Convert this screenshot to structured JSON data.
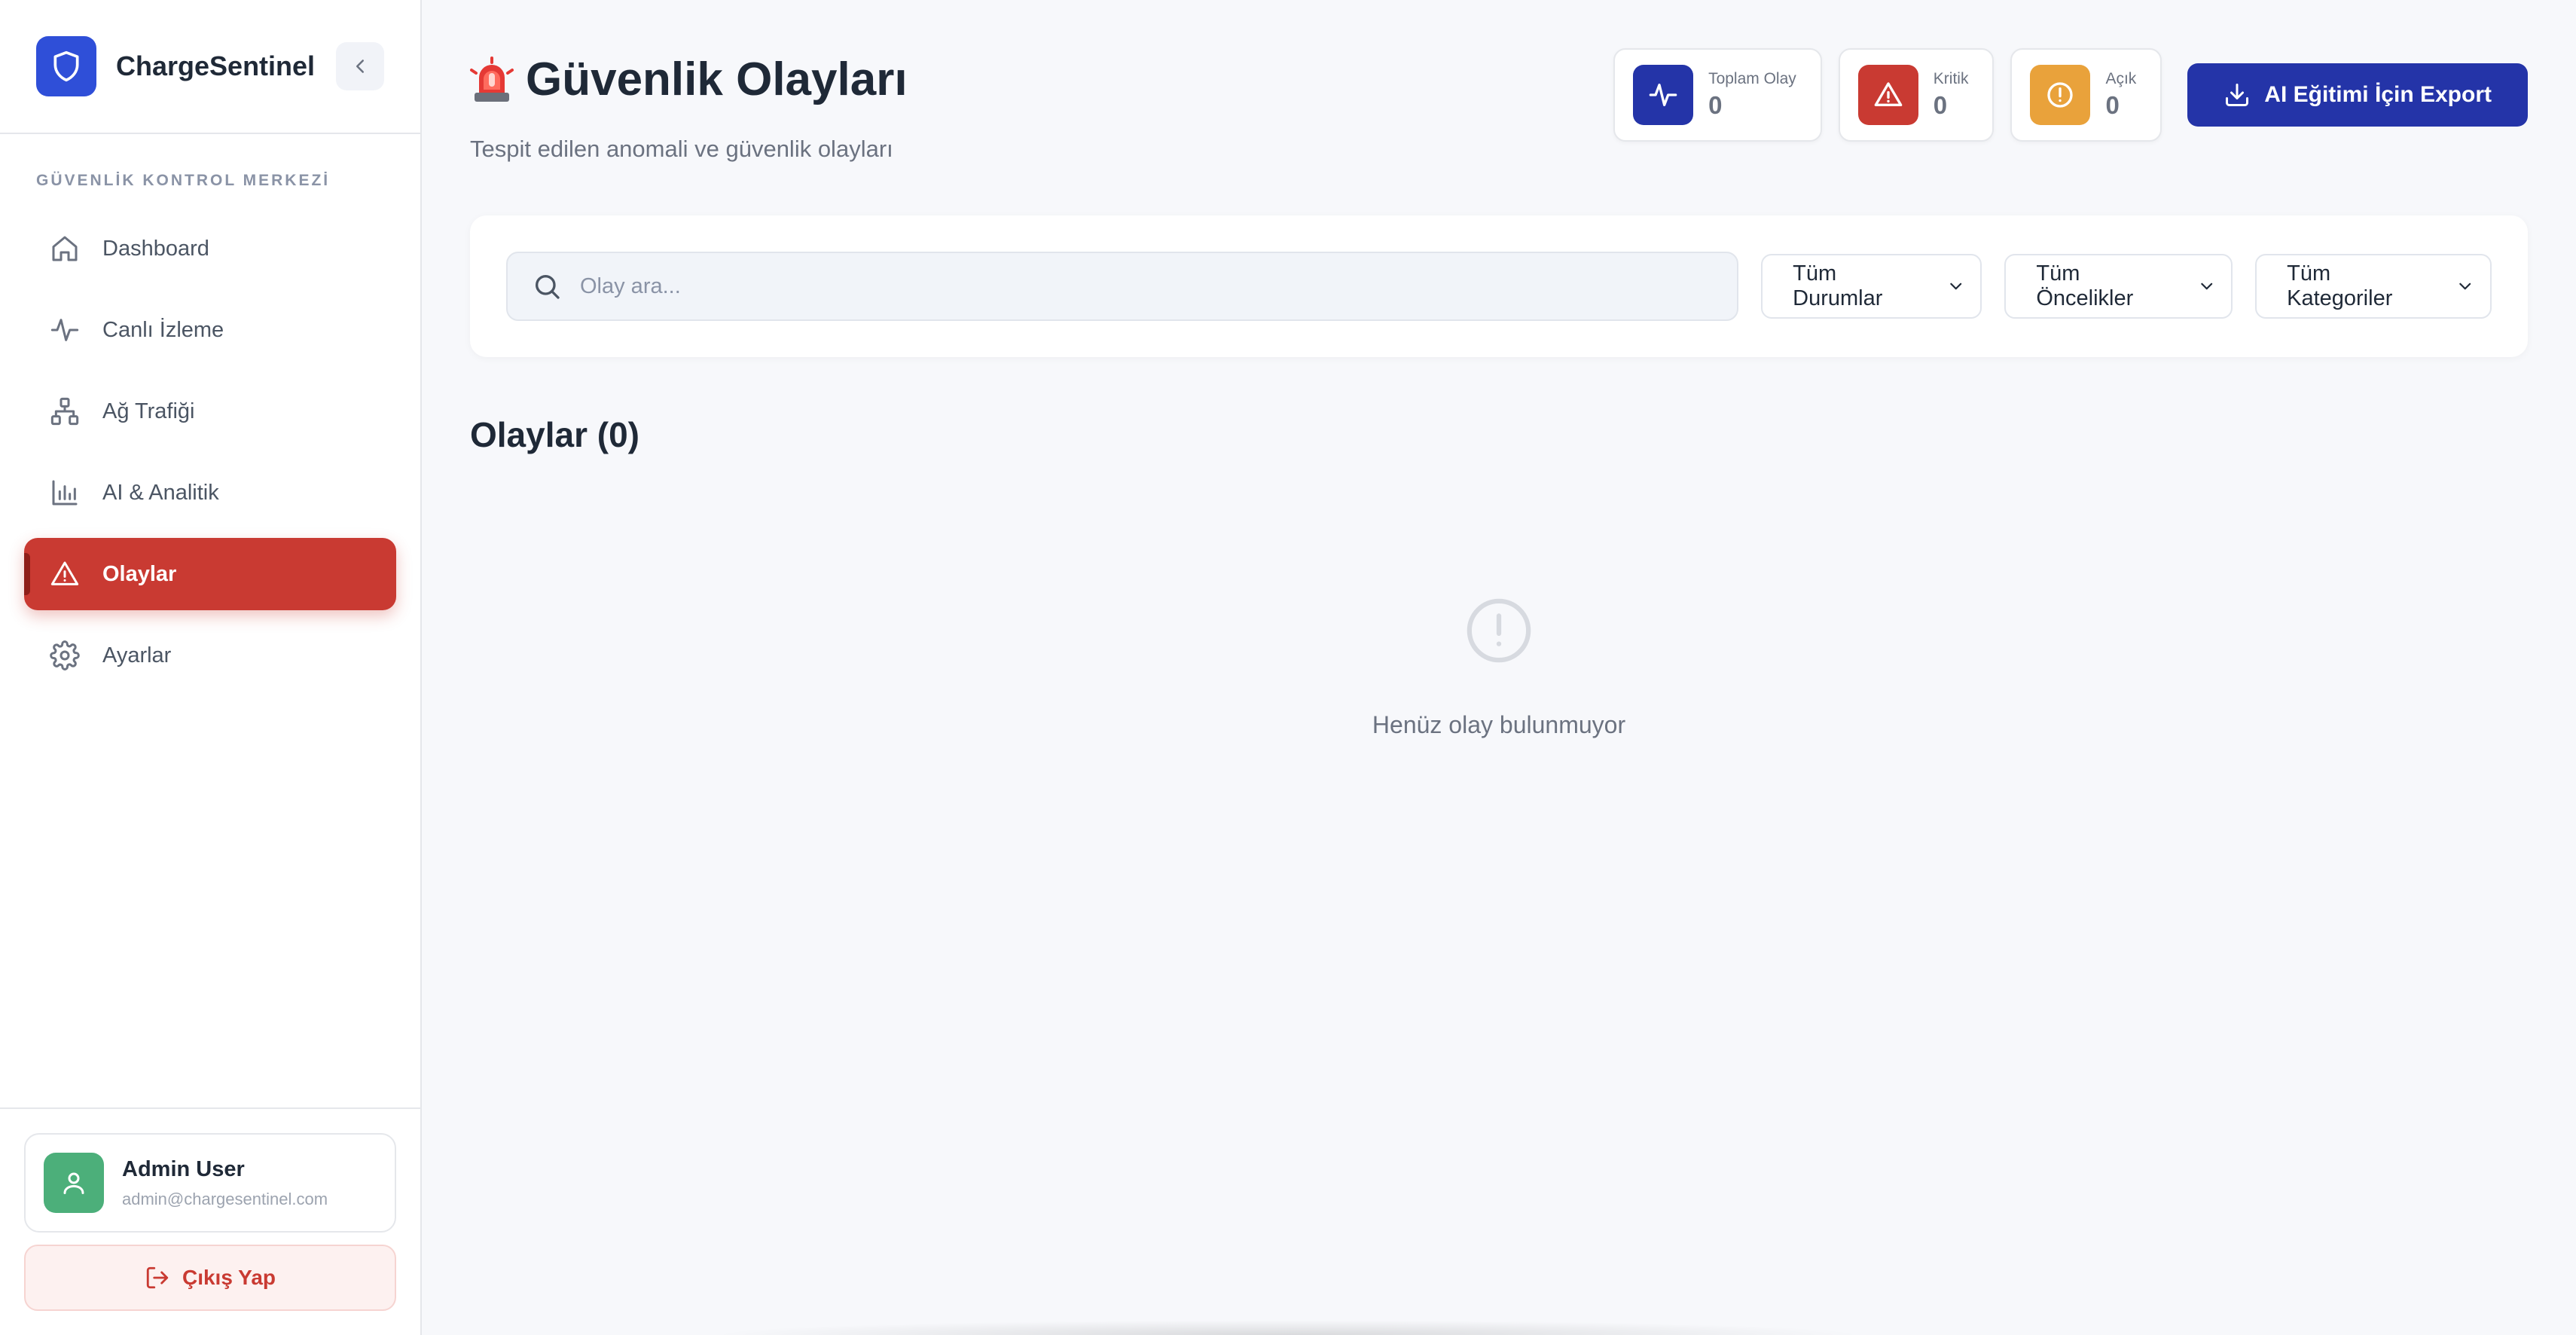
{
  "sidebar": {
    "brand": {
      "name": "ChargeSentinel",
      "logo_icon": "shield-icon",
      "collapse_icon": "chevron-left-icon"
    },
    "section_title": "GÜVENLİK KONTROL MERKEZİ",
    "items": [
      {
        "label": "Dashboard",
        "icon": "home-icon",
        "active": false
      },
      {
        "label": "Canlı İzleme",
        "icon": "activity-icon",
        "active": false
      },
      {
        "label": "Ağ Trafiği",
        "icon": "network-icon",
        "active": false
      },
      {
        "label": "AI & Analitik",
        "icon": "bar-chart-icon",
        "active": false
      },
      {
        "label": "Olaylar",
        "icon": "warning-triangle-icon",
        "active": true
      },
      {
        "label": "Ayarlar",
        "icon": "gear-icon",
        "active": false
      }
    ],
    "user": {
      "name": "Admin User",
      "email": "admin@chargesentinel.com",
      "avatar_icon": "user-icon"
    },
    "logout_label": "Çıkış Yap"
  },
  "header": {
    "title": "Güvenlik Olayları",
    "title_icon": "siren-icon",
    "subtitle": "Tespit edilen anomali ve güvenlik olayları",
    "stats": [
      {
        "label": "Toplam Olay",
        "value": "0",
        "icon": "activity-icon",
        "color": "#2434a8"
      },
      {
        "label": "Kritik",
        "value": "0",
        "icon": "warning-triangle-icon",
        "color": "#c93a32"
      },
      {
        "label": "Açık",
        "value": "0",
        "icon": "alert-circle-icon",
        "color": "#e9a23b"
      }
    ],
    "export_label": "AI Eğitimi İçin Export",
    "export_icon": "download-icon"
  },
  "filters": {
    "search_placeholder": "Olay ara...",
    "status_select": "Tüm Durumlar",
    "priority_select": "Tüm Öncelikler",
    "category_select": "Tüm Kategoriler"
  },
  "events": {
    "title": "Olaylar (0)",
    "empty_text": "Henüz olay bulunmuyor"
  },
  "colors": {
    "accent": "#2f4fd8",
    "danger": "#c93a32",
    "warning": "#e9a23b",
    "primary_button": "#2434a8"
  }
}
